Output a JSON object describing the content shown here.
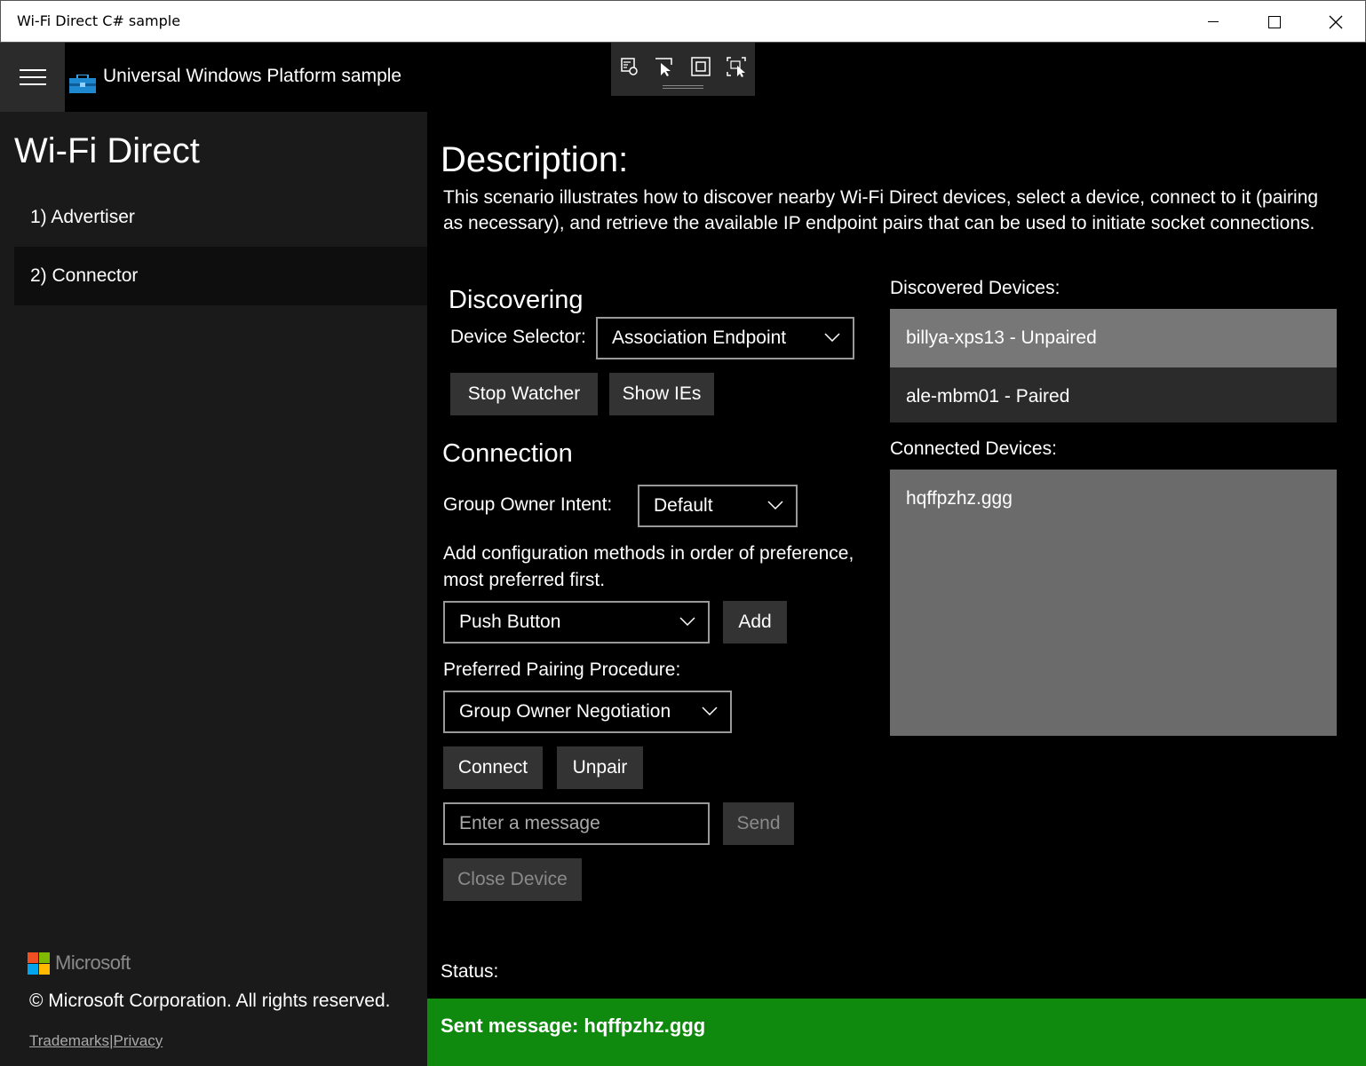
{
  "window": {
    "title": "Wi-Fi Direct C# sample"
  },
  "header": {
    "app_title": "Universal Windows Platform sample"
  },
  "sidebar": {
    "title": "Wi-Fi Direct",
    "items": [
      {
        "label": "1) Advertiser",
        "selected": false
      },
      {
        "label": "2) Connector",
        "selected": true
      }
    ],
    "brand": "Microsoft",
    "copyright": "© Microsoft Corporation. All rights reserved.",
    "links": {
      "trademarks": "Trademarks",
      "separator": "|",
      "privacy": "Privacy"
    }
  },
  "main": {
    "description_title": "Description:",
    "description_text": "This scenario illustrates how to discover nearby Wi-Fi Direct devices, select a device, connect to it (pairing as necessary), and retrieve the available IP endpoint pairs that can be used to initiate socket connections.",
    "discovering": {
      "title": "Discovering",
      "device_selector_label": "Device Selector:",
      "device_selector_value": "Association Endpoint",
      "stop_watcher": "Stop Watcher",
      "show_ies": "Show IEs"
    },
    "connection": {
      "title": "Connection",
      "group_owner_intent_label": "Group Owner Intent:",
      "group_owner_intent_value": "Default",
      "config_methods_label_line1": "Add configuration methods in order of preference,",
      "config_methods_label_line2": "most preferred first.",
      "config_method_value": "Push Button",
      "add": "Add",
      "pairing_procedure_label": "Preferred Pairing Procedure:",
      "pairing_procedure_value": "Group Owner Negotiation",
      "connect": "Connect",
      "unpair": "Unpair",
      "message_placeholder": "Enter a message",
      "send": "Send",
      "close_device": "Close Device"
    },
    "discovered_devices": {
      "label": "Discovered Devices:",
      "items": [
        {
          "name": "billya-xps13 - Unpaired",
          "selected": true
        },
        {
          "name": "ale-mbm01 - Paired",
          "selected": false
        }
      ]
    },
    "connected_devices": {
      "label": "Connected Devices:",
      "items": [
        {
          "name": "hqffpzhz.ggg"
        }
      ]
    },
    "status_label": "Status:",
    "status_message": "Sent message: hqffpzhz.ggg"
  },
  "colors": {
    "status_success": "#0f8a0f",
    "selected_item": "#777777",
    "list_background": "#2b2b2b"
  }
}
